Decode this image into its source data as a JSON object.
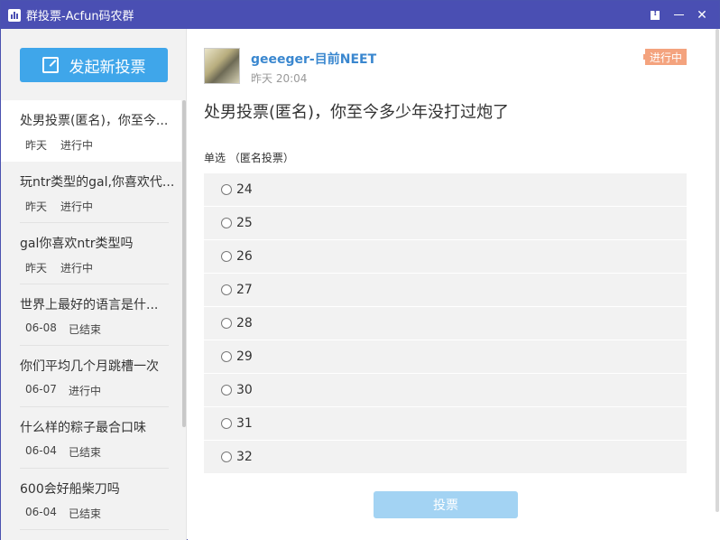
{
  "window": {
    "title": "群投票-Acfun码农群",
    "icon": "bar-chart-icon",
    "buttons": [
      "feedback-icon",
      "minimize-icon",
      "close-icon"
    ],
    "close_glyph": "✕"
  },
  "sidebar": {
    "new_vote_label": "发起新投票",
    "items": [
      {
        "title": "处男投票(匿名)，你至今...",
        "date": "昨天",
        "status": "进行中",
        "active": true
      },
      {
        "title": "玩ntr类型的gal,你喜欢代...",
        "date": "昨天",
        "status": "进行中"
      },
      {
        "title": "gal你喜欢ntr类型吗",
        "date": "昨天",
        "status": "进行中"
      },
      {
        "title": "世界上最好的语言是什...",
        "date": "06-08",
        "status": "已结束"
      },
      {
        "title": "你们平均几个月跳槽一次",
        "date": "06-07",
        "status": "进行中"
      },
      {
        "title": "什么样的粽子最合口味",
        "date": "06-04",
        "status": "已结束"
      },
      {
        "title": "600会好船柴刀吗",
        "date": "06-04",
        "status": "已结束"
      }
    ]
  },
  "main": {
    "author": "geeeger-目前NEET",
    "time": "昨天 20:04",
    "status_badge": "进行中",
    "question": "处男投票(匿名)，你至今多少年没打过炮了",
    "vote_type": "单选 （匿名投票）",
    "options": [
      "24",
      "25",
      "26",
      "27",
      "28",
      "29",
      "30",
      "31",
      "32"
    ],
    "submit_label": "投票"
  },
  "colors": {
    "titlebar": "#4a4fb3",
    "accent": "#3fa6ea",
    "author": "#3a87cf",
    "badge": "#f4a37e",
    "submit_disabled": "#a3d3f3"
  }
}
